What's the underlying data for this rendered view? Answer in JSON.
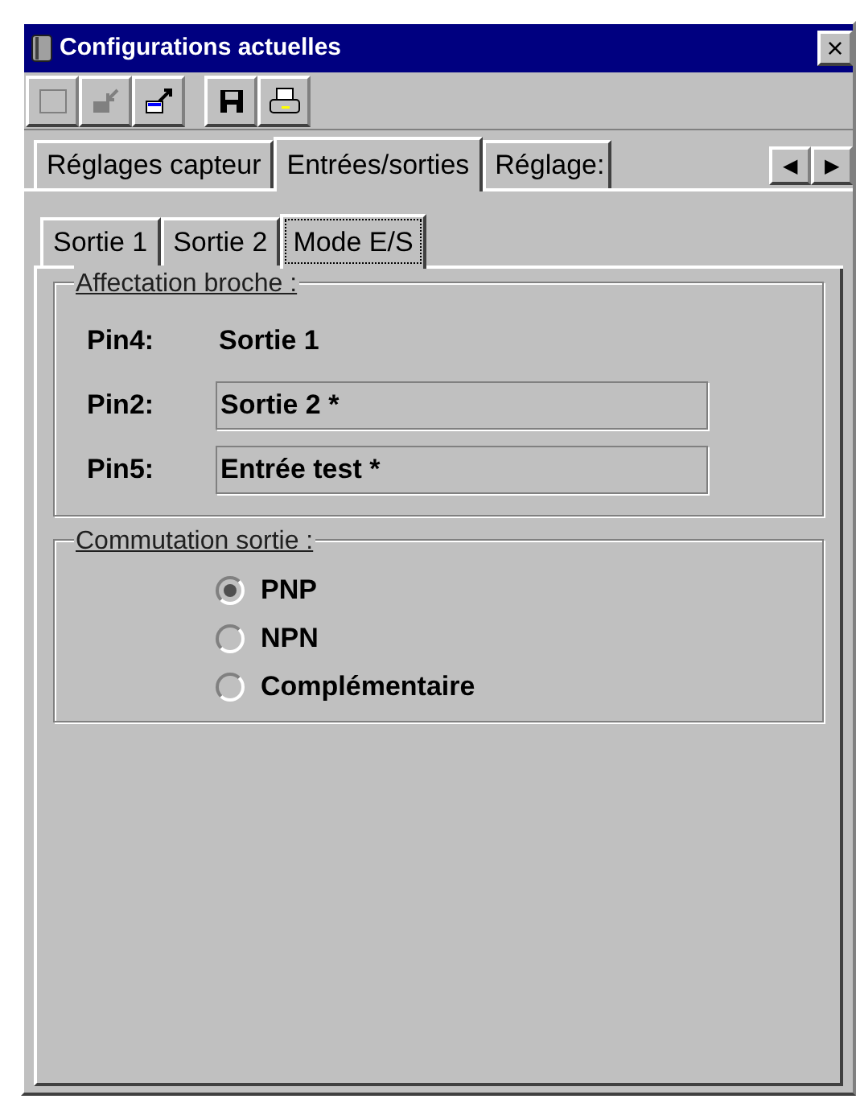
{
  "window": {
    "title": "Configurations actuelles",
    "close": "×"
  },
  "toolbar": [
    {
      "kind": "blank",
      "disabled": true
    },
    {
      "kind": "import",
      "disabled": true
    },
    {
      "kind": "export",
      "disabled": false
    },
    {
      "kind": "save",
      "disabled": false
    },
    {
      "kind": "print",
      "disabled": false
    }
  ],
  "tabs": [
    {
      "label": "Réglages capteur",
      "selected": false
    },
    {
      "label": "Entrées/sorties",
      "selected": true
    },
    {
      "label": "Réglage:",
      "selected": false
    }
  ],
  "tab_scroll": [
    "◀",
    "▶"
  ],
  "subtabs": [
    {
      "label": "Sortie 1",
      "selected": false
    },
    {
      "label": "Sortie 2",
      "selected": false
    },
    {
      "label": "Mode E/S",
      "selected": true
    }
  ],
  "pin_group": {
    "title": "Affectation broche :",
    "pins": [
      {
        "label": "Pin4:",
        "value": "Sortie 1",
        "kind": "text"
      },
      {
        "label": "Pin2:",
        "value": "Sortie 2 *",
        "kind": "field"
      },
      {
        "label": "Pin5:",
        "value": "Entrée test *",
        "kind": "field"
      }
    ]
  },
  "switch_group": {
    "title": "Commutation sortie :",
    "options": [
      {
        "label": "PNP",
        "selected": true,
        "disabled": true
      },
      {
        "label": "NPN",
        "selected": false,
        "disabled": true
      },
      {
        "label": "Complémentaire",
        "selected": false,
        "disabled": true
      }
    ]
  }
}
